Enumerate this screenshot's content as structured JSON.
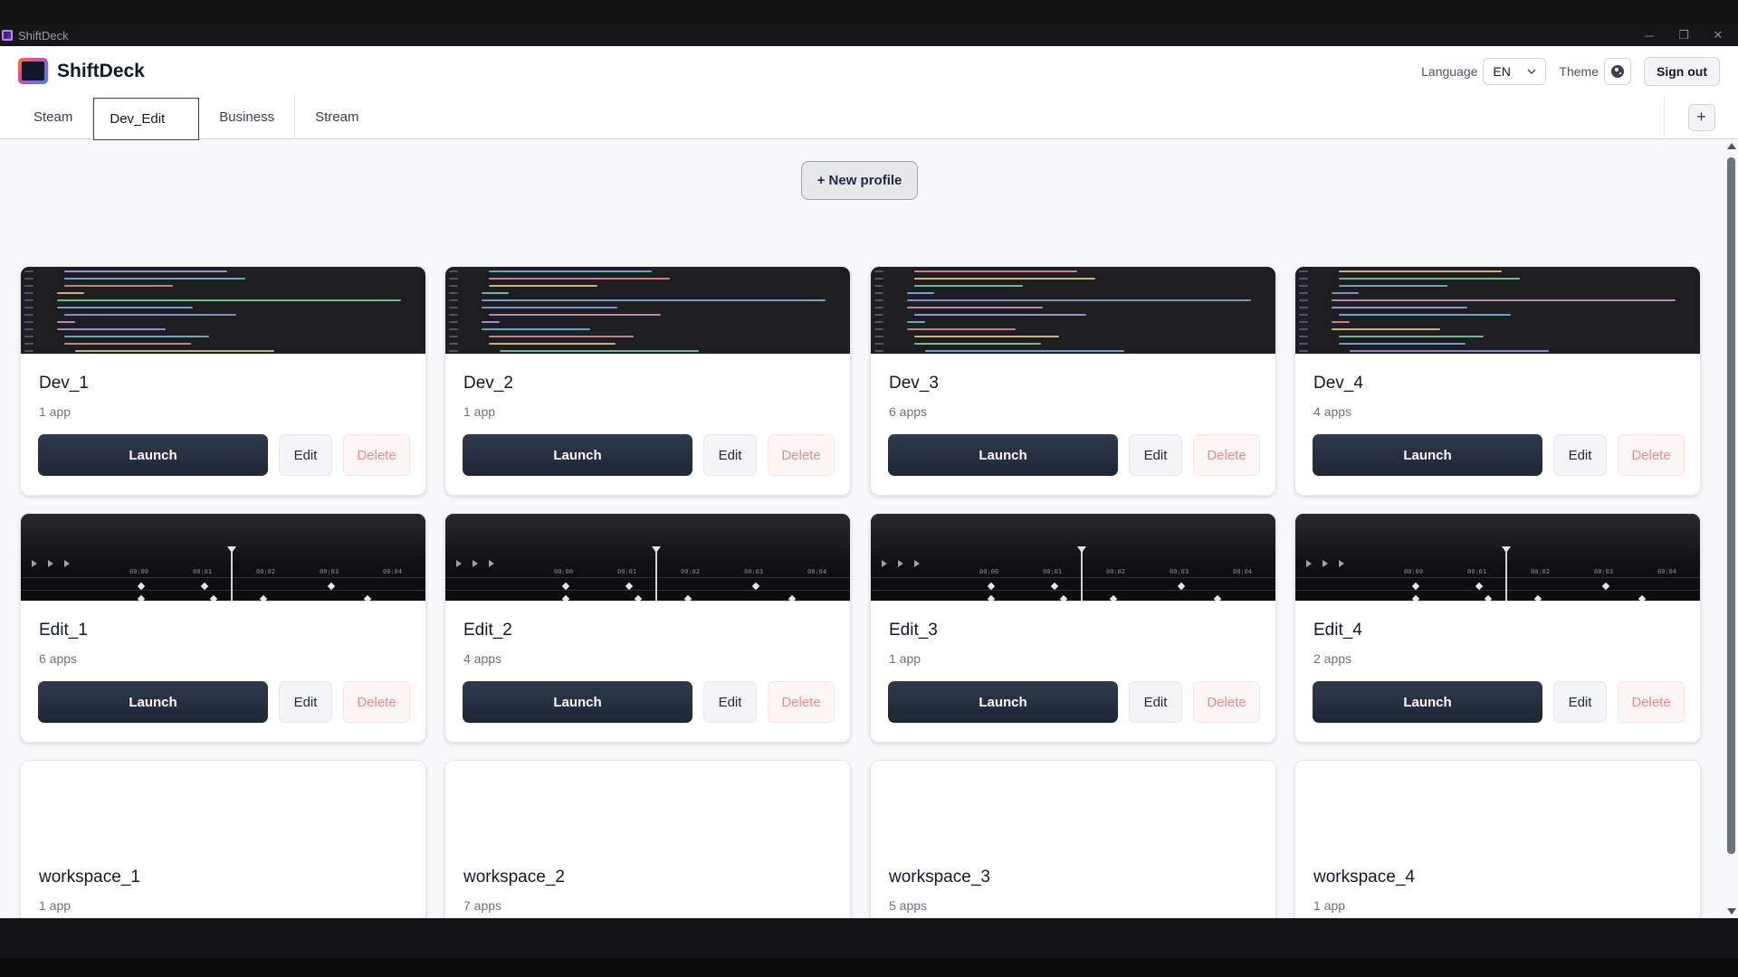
{
  "window": {
    "title": "ShiftDeck",
    "controls": [
      "─",
      "❐",
      "✕"
    ]
  },
  "header": {
    "brand": "ShiftDeck",
    "language_label": "Language",
    "language_value": "EN",
    "theme_label": "Theme",
    "sign_out": "Sign out"
  },
  "tabs": [
    {
      "label": "Steam",
      "active": false
    },
    {
      "label": "Dev_Edit",
      "active": true
    },
    {
      "label": "Business",
      "active": false
    },
    {
      "label": "Stream",
      "active": false
    }
  ],
  "add_tab": "+",
  "new_profile": "+ New profile",
  "buttons": {
    "launch": "Launch",
    "edit": "Edit",
    "delete": "Delete"
  },
  "profiles": [
    {
      "name": "Dev_1",
      "apps": "1 app",
      "preview": "code"
    },
    {
      "name": "Dev_2",
      "apps": "1 app",
      "preview": "code"
    },
    {
      "name": "Dev_3",
      "apps": "6 apps",
      "preview": "code"
    },
    {
      "name": "Dev_4",
      "apps": "4 apps",
      "preview": "code"
    },
    {
      "name": "Edit_1",
      "apps": "6 apps",
      "preview": "timeline"
    },
    {
      "name": "Edit_2",
      "apps": "4 apps",
      "preview": "timeline"
    },
    {
      "name": "Edit_3",
      "apps": "1 app",
      "preview": "timeline"
    },
    {
      "name": "Edit_4",
      "apps": "2 apps",
      "preview": "timeline"
    },
    {
      "name": "workspace_1",
      "apps": "1 app",
      "preview": "blank"
    },
    {
      "name": "workspace_2",
      "apps": "7 apps",
      "preview": "blank"
    },
    {
      "name": "workspace_3",
      "apps": "5 apps",
      "preview": "blank"
    },
    {
      "name": "workspace_4",
      "apps": "1 app",
      "preview": "blank"
    }
  ],
  "colors": {
    "launch_bg": "#243040",
    "delete_text": "#f08a8a",
    "accent": "#374151"
  }
}
